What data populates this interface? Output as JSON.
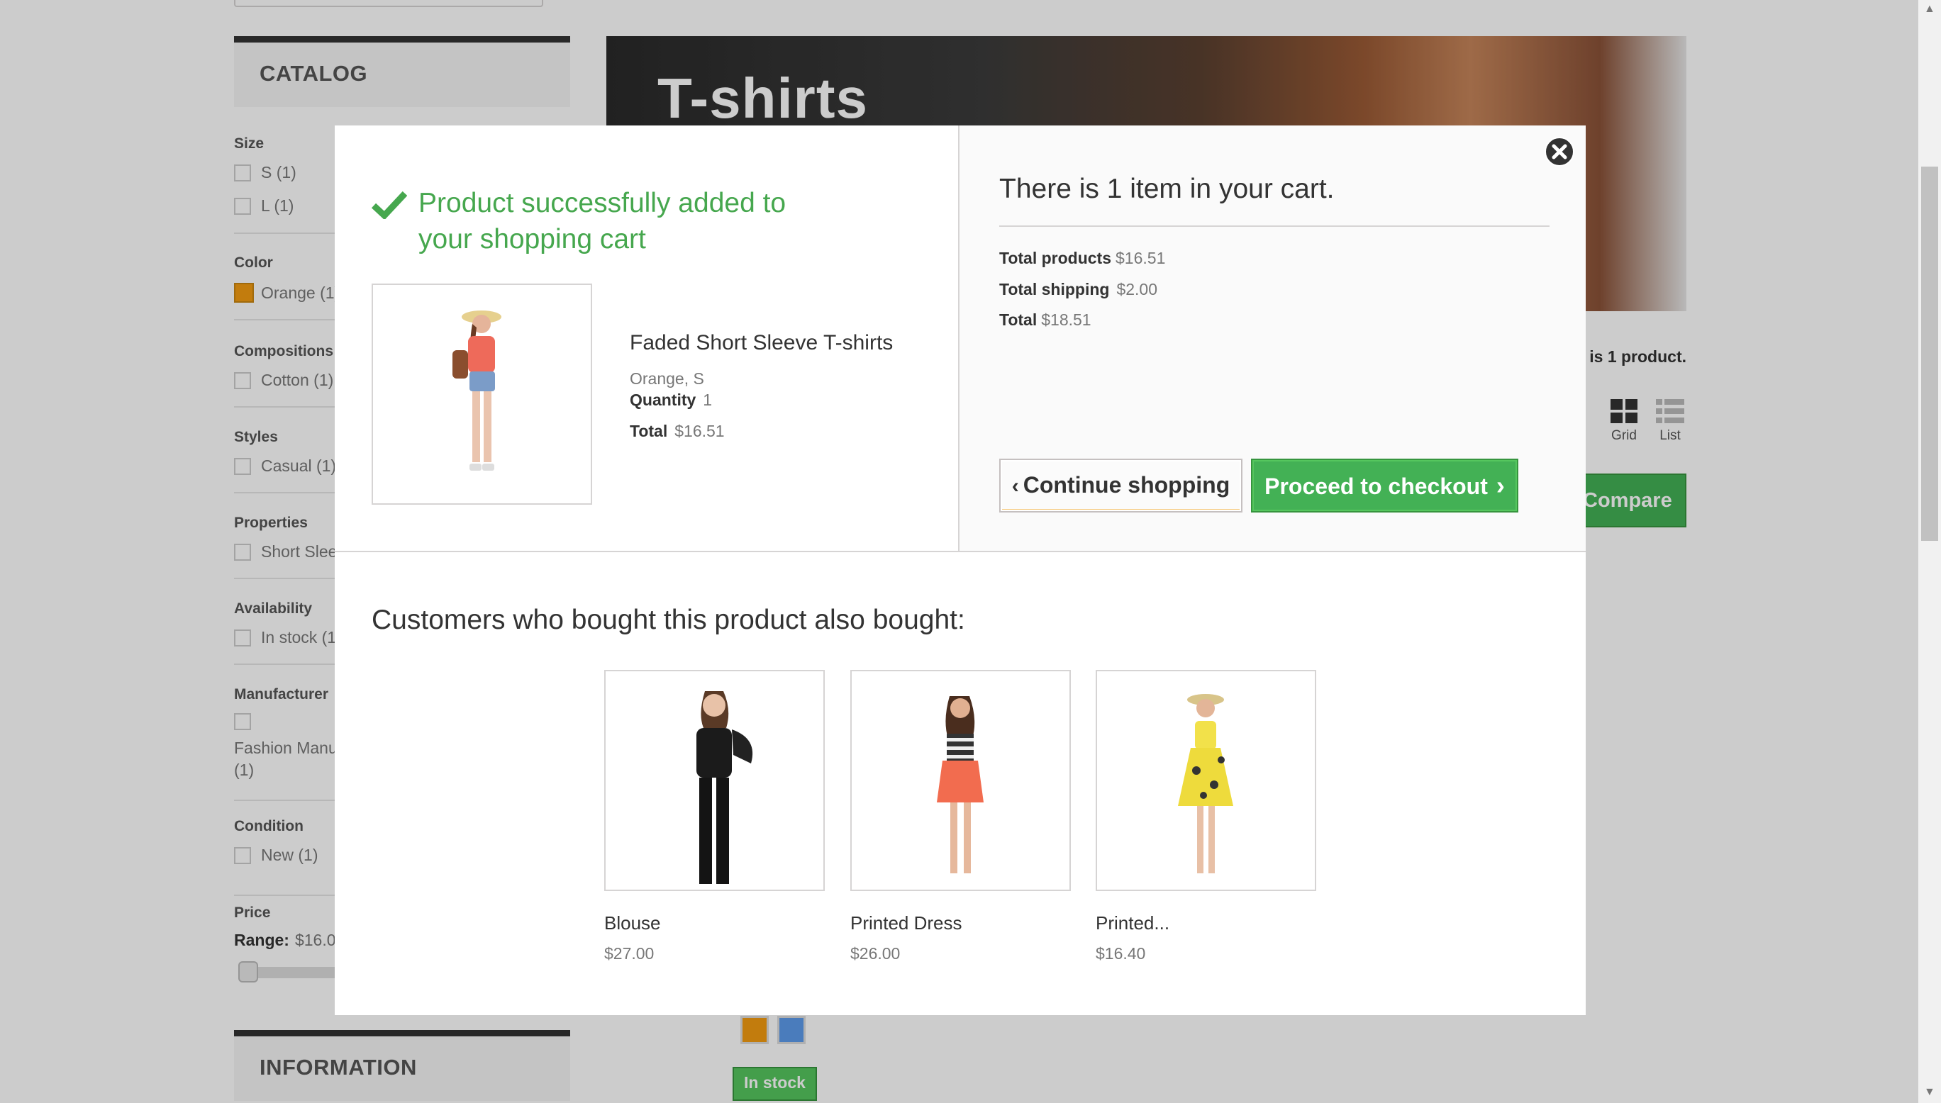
{
  "sidebar": {
    "catalog_title": "CATALOG",
    "information_title": "INFORMATION",
    "filters": {
      "size": {
        "title": "Size",
        "items": [
          "S (1)",
          "L (1)"
        ]
      },
      "color": {
        "title": "Color",
        "items": [
          "Orange (1)"
        ],
        "swatch": "#f39c11"
      },
      "compositions": {
        "title": "Compositions",
        "items": [
          "Cotton (1)"
        ]
      },
      "styles": {
        "title": "Styles",
        "items": [
          "Casual (1)"
        ]
      },
      "properties": {
        "title": "Properties",
        "items": [
          "Short Sleeve"
        ]
      },
      "availability": {
        "title": "Availability",
        "items": [
          "In stock (1)"
        ]
      },
      "manufacturer": {
        "title": "Manufacturer",
        "items": [
          "Fashion Manufacturer",
          "(1)"
        ]
      },
      "condition": {
        "title": "Condition",
        "items": [
          "New (1)"
        ]
      },
      "price": {
        "title": "Price",
        "range_label": "Range:",
        "range_value": "$16.00"
      }
    }
  },
  "main": {
    "category_title": "T-shirts",
    "product_count": "There is 1 product.",
    "views": {
      "grid": "Grid",
      "list": "List"
    },
    "compare_label": "Compare (0)",
    "in_stock": "In stock",
    "color_swatches": [
      "#f39c11",
      "#5d9cec"
    ]
  },
  "modal": {
    "success_message": "Product successfully added to your shopping cart",
    "product": {
      "name": "Faded Short Sleeve T-shirts",
      "attributes": "Orange, S",
      "quantity_label": "Quantity",
      "quantity": "1",
      "total_label": "Total",
      "total": "$16.51"
    },
    "cart": {
      "title": "There is 1 item in your cart.",
      "total_products_label": "Total products",
      "total_products": "$16.51",
      "total_shipping_label": "Total shipping",
      "total_shipping": "$2.00",
      "total_label": "Total",
      "total": "$18.51"
    },
    "continue_label": "Continue shopping",
    "checkout_label": "Proceed to checkout",
    "also_bought_title": "Customers who bought this product also bought:",
    "also_bought": [
      {
        "name": "Blouse",
        "price": "$27.00"
      },
      {
        "name": "Printed Dress",
        "price": "$26.00"
      },
      {
        "name": "Printed...",
        "price": "$16.40"
      }
    ]
  },
  "colors": {
    "success": "#46a74e",
    "button_green": "#43b155",
    "brand_orange": "#f39c11"
  }
}
